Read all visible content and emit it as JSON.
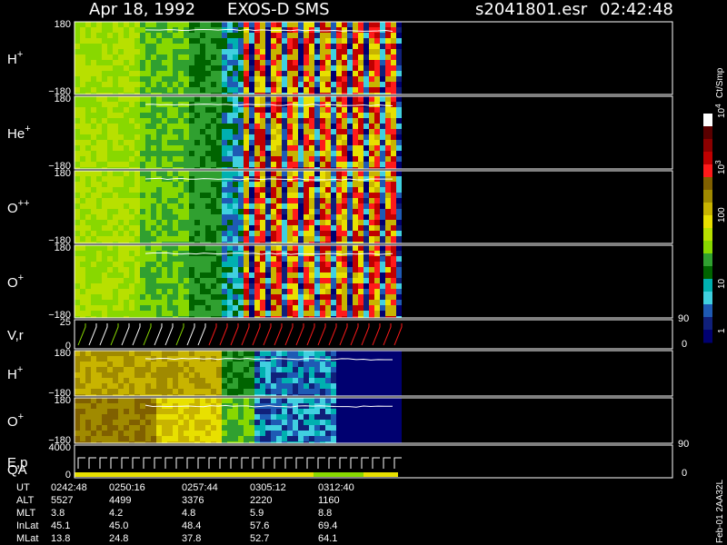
{
  "header": {
    "date": "Apr 18, 1992",
    "instrument": "EXOS-D SMS",
    "file": "s2041801.esr",
    "time": "02:42:48"
  },
  "colorbar": {
    "unit": "Ct/Smp",
    "ticks": [
      "1",
      "10",
      "100",
      "10",
      "10"
    ],
    "tick_powers": [
      "",
      "",
      "",
      "3",
      "4"
    ],
    "colors": [
      "#ffffff",
      "#5a0000",
      "#8b0000",
      "#c00000",
      "#ff1a1a",
      "#806000",
      "#a08a00",
      "#c8b400",
      "#e8e000",
      "#b8e000",
      "#88d800",
      "#30a030",
      "#006400",
      "#00b0b0",
      "#40d0e0",
      "#1e5ab4",
      "#10207a",
      "#000070"
    ]
  },
  "panels": [
    {
      "id": "h-plus",
      "label": "H",
      "sup": "+",
      "ytop": "180",
      "ybot": "−180"
    },
    {
      "id": "he-plus",
      "label": "He",
      "sup": "+",
      "ytop": "180",
      "ybot": "−180"
    },
    {
      "id": "o-plus-plus",
      "label": "O",
      "sup": "++",
      "ytop": "180",
      "ybot": "−180"
    },
    {
      "id": "o-plus",
      "label": "O",
      "sup": "+",
      "ytop": "180",
      "ybot": "−180"
    },
    {
      "id": "vr",
      "label": "V,r",
      "sup": "",
      "ytop": "25",
      "ybot": "0",
      "rtop": "90",
      "rbot": "0"
    },
    {
      "id": "h-plus-2",
      "label": "H",
      "sup": "+",
      "ytop": "180",
      "ybot": "−180"
    },
    {
      "id": "o-plus-2",
      "label": "O",
      "sup": "+",
      "ytop": "180",
      "ybot": "−180"
    },
    {
      "id": "ep",
      "label": "E,p",
      "label2": "QA",
      "sup": "",
      "ytop": "4000",
      "ybot": "0",
      "rtop": "90",
      "rbot": "0"
    }
  ],
  "ephemeris": {
    "rows": [
      {
        "name": "UT",
        "values": [
          "0242:48",
          "0250:16",
          "0257:44",
          "0305:12",
          "0312:40"
        ]
      },
      {
        "name": "ALT",
        "values": [
          "5527",
          "4499",
          "3376",
          "2220",
          "1160"
        ]
      },
      {
        "name": "MLT",
        "values": [
          "3.8",
          "4.2",
          "4.8",
          "5.9",
          "8.8"
        ]
      },
      {
        "name": "InLat",
        "values": [
          "45.1",
          "45.0",
          "48.4",
          "57.6",
          "69.4"
        ]
      },
      {
        "name": "MLat",
        "values": [
          "13.8",
          "24.8",
          "37.8",
          "52.7",
          "64.1"
        ]
      }
    ]
  },
  "footer_tag": "Feb-01 2AA32L"
}
